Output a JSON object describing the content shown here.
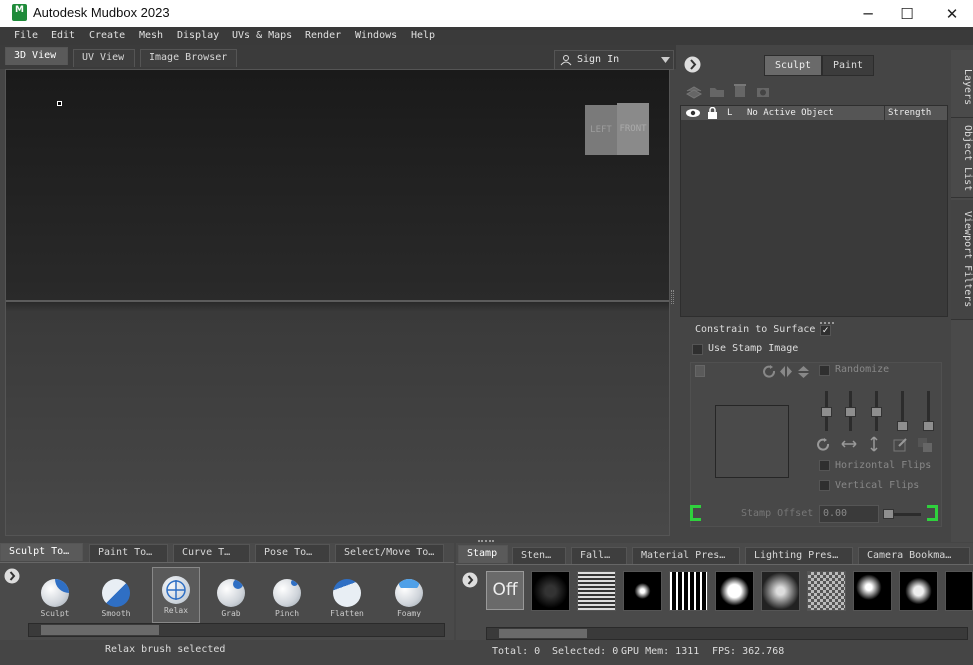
{
  "window": {
    "title": "Autodesk Mudbox 2023",
    "logo_text": "M",
    "controls": [
      "─",
      "☐",
      "✕"
    ]
  },
  "menu": [
    "File",
    "Edit",
    "Create",
    "Mesh",
    "Display",
    "UVs & Maps",
    "Render",
    "Windows",
    "Help"
  ],
  "view_tabs": [
    "3D View",
    "UV View",
    "Image Browser"
  ],
  "sign_in": "Sign In",
  "viewcube": {
    "left": "LEFT",
    "front": "FRONT"
  },
  "mode_tabs": {
    "sculpt": "Sculpt",
    "paint": "Paint"
  },
  "layers": {
    "header_lock": "L",
    "header_name": "No Active Object",
    "header_strength": "Strength"
  },
  "side_tabs": [
    "Layers",
    "Object List",
    "Viewport Filters"
  ],
  "properties": {
    "constrain_to_surface": "Constrain to Surface",
    "constrain_checked": "✓",
    "use_stamp_image": "Use Stamp Image",
    "randomize": "Randomize",
    "horizontal_flips": "Horizontal Flips",
    "vertical_flips": "Vertical Flips",
    "stamp_offset_label": "Stamp Offset",
    "stamp_offset_value": "0.00"
  },
  "tool_tabs": [
    "Sculpt To…",
    "Paint To…",
    "Curve T…",
    "Pose To…",
    "Select/Move To…"
  ],
  "brushes": [
    "Sculpt",
    "Smooth",
    "Relax",
    "Grab",
    "Pinch",
    "Flatten",
    "Foamy"
  ],
  "stamp_tabs": [
    "Stamp",
    "Sten…",
    "Fall…",
    "Material Pres…",
    "Lighting Pres…",
    "Camera Bookma…"
  ],
  "stamp_off": "Off",
  "status": {
    "message": "Relax brush selected",
    "total": "Total: 0",
    "selected": "Selected: 0",
    "gpu_mem": "GPU Mem: 1311",
    "fps": "FPS: 362.768"
  },
  "colors": {
    "logo": "#1f8b3a",
    "accent_brush": "#2f6fc4"
  }
}
